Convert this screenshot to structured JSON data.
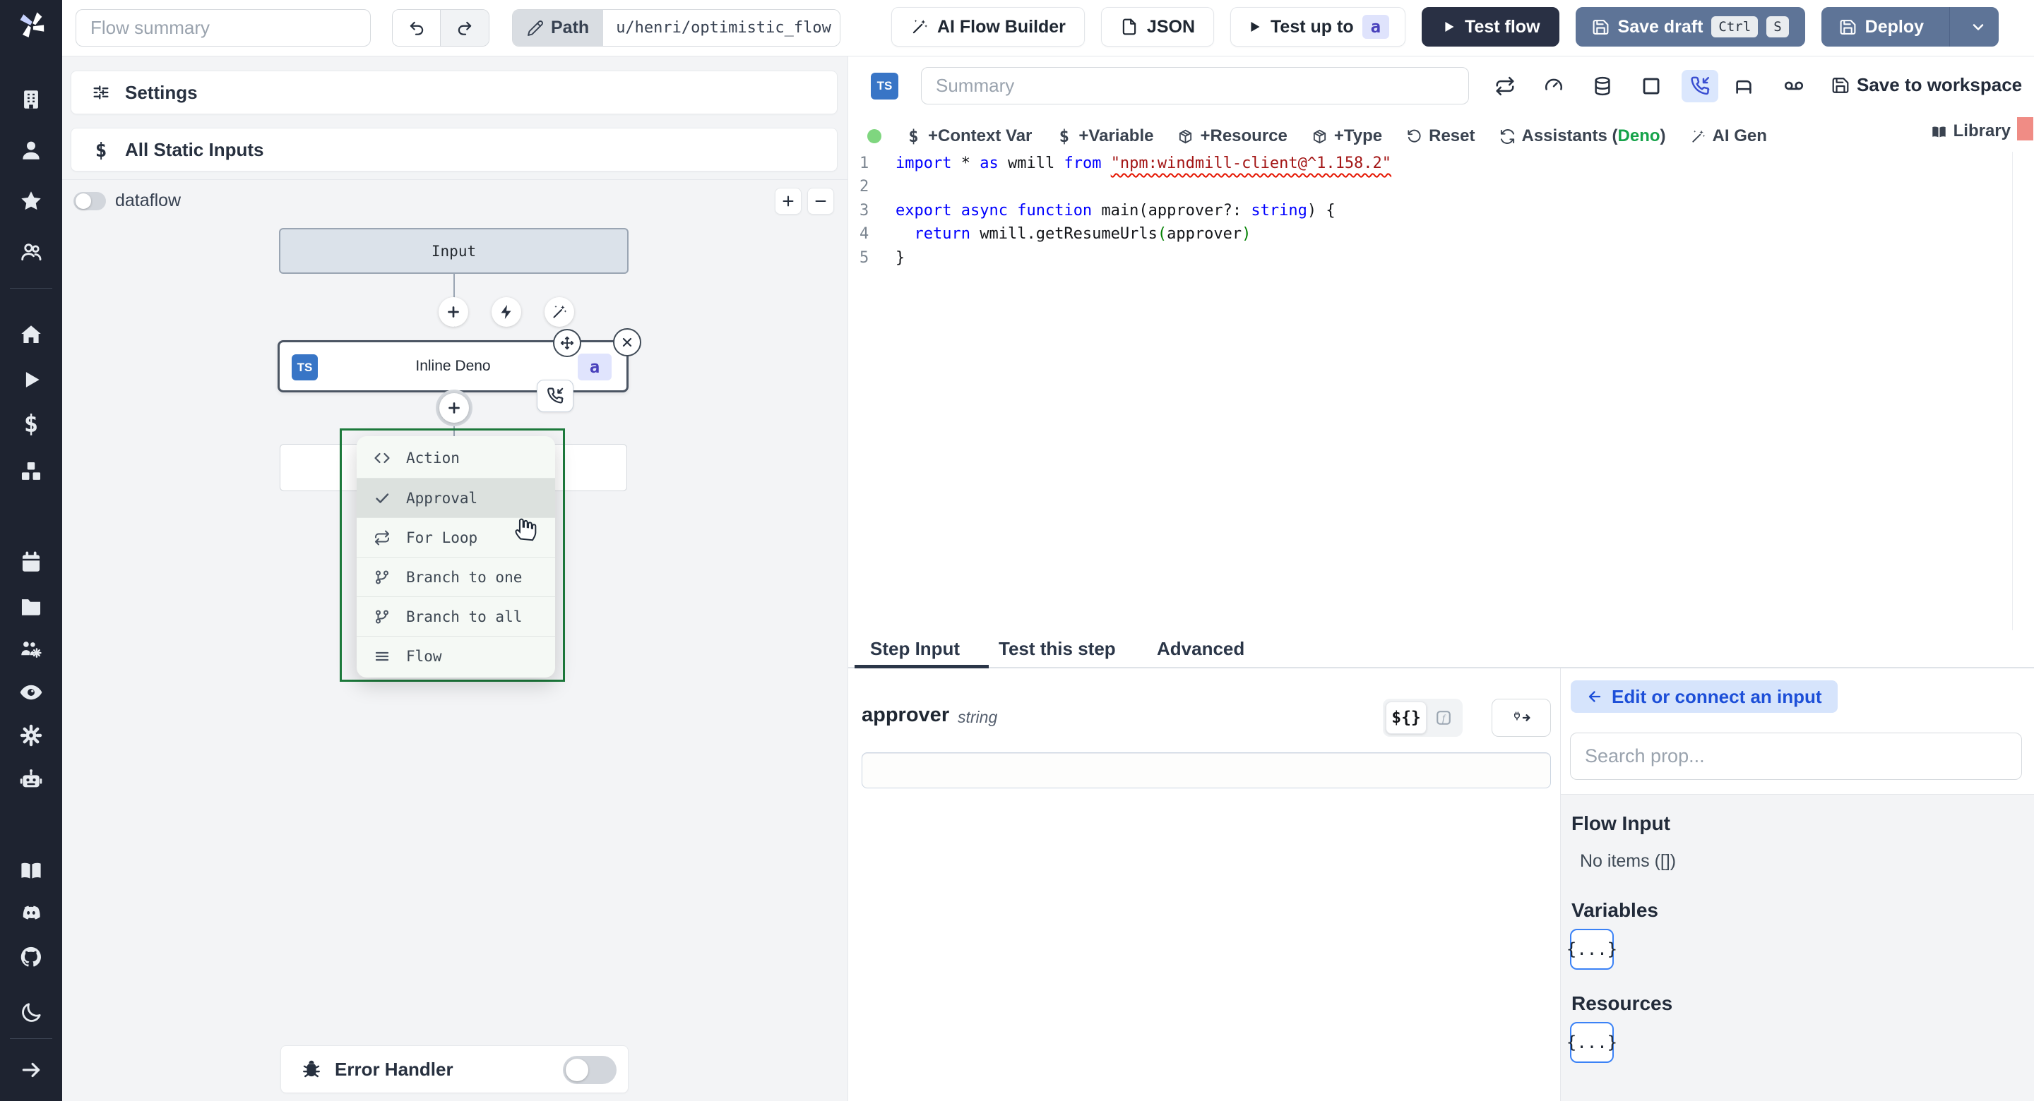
{
  "topbar": {
    "flow_summary_placeholder": "Flow summary",
    "path_label": "Path",
    "path_value": "u/henri/optimistic_flow",
    "ai_flow_builder": "AI Flow Builder",
    "json": "JSON",
    "test_up_to": "Test up to",
    "test_up_to_badge": "a",
    "test_flow": "Test flow",
    "save_draft": "Save draft",
    "kbd_ctrl": "Ctrl",
    "kbd_s": "S",
    "deploy": "Deploy"
  },
  "sidebar": {
    "items": [
      {
        "name": "workspace",
        "icon": "building"
      },
      {
        "name": "user",
        "icon": "user"
      },
      {
        "name": "favorites",
        "icon": "star"
      },
      {
        "name": "groups",
        "icon": "users"
      },
      {
        "divider": true
      },
      {
        "name": "home",
        "icon": "home"
      },
      {
        "name": "runs",
        "icon": "play"
      },
      {
        "name": "variables",
        "icon": "dollar"
      },
      {
        "name": "resources",
        "icon": "boxes"
      },
      {
        "name": "schedules",
        "icon": "calendar"
      },
      {
        "name": "folders",
        "icon": "folder"
      },
      {
        "name": "groups-admin",
        "icon": "users-cog"
      },
      {
        "name": "audit-logs",
        "icon": "eye"
      },
      {
        "name": "settings",
        "icon": "gear"
      },
      {
        "name": "workers",
        "icon": "bot"
      },
      {
        "name": "docs",
        "icon": "book"
      },
      {
        "name": "discord",
        "icon": "discord"
      },
      {
        "name": "github",
        "icon": "github"
      },
      {
        "name": "dark-mode",
        "icon": "moon"
      },
      {
        "divider": true
      },
      {
        "name": "expand-sidebar",
        "icon": "arrow-right"
      }
    ]
  },
  "flow_panel": {
    "settings": "Settings",
    "all_static_inputs": "All Static Inputs",
    "dataflow_label": "dataflow",
    "input_node": "Input",
    "step_node": "Inline Deno",
    "step_node_lang_badge": "TS",
    "step_node_id_badge": "a",
    "error_handler": "Error Handler"
  },
  "flow_menu": {
    "items": [
      {
        "label": "Action",
        "icon": "code"
      },
      {
        "label": "Approval",
        "icon": "check",
        "active": true
      },
      {
        "label": "For Loop",
        "icon": "repeat"
      },
      {
        "label": "Branch to one",
        "icon": "git-branch"
      },
      {
        "label": "Branch to all",
        "icon": "git-branch"
      },
      {
        "label": "Flow",
        "icon": "menu"
      }
    ]
  },
  "editor": {
    "lang_badge": "TS",
    "summary_placeholder": "Summary",
    "save_to_workspace": "Save to workspace",
    "toolbar": {
      "context_var": "+Context Var",
      "variable": "+Variable",
      "resource": "+Resource",
      "type": "+Type",
      "reset": "Reset",
      "assistants_prefix": "Assistants (",
      "assistants_lang": "Deno",
      "assistants_suffix": ")",
      "ai_gen": "AI Gen",
      "library": "Library"
    },
    "code": {
      "lines": [
        {
          "n": "1",
          "tokens": [
            {
              "t": "import",
              "c": "kw"
            },
            {
              "t": " * ",
              "c": "pl"
            },
            {
              "t": "as",
              "c": "kw"
            },
            {
              "t": " wmill ",
              "c": "pl"
            },
            {
              "t": "from",
              "c": "kw"
            },
            {
              "t": " ",
              "c": "pl"
            },
            {
              "t": "\"npm:windmill-client@^1.158.2\"",
              "c": "str"
            }
          ]
        },
        {
          "n": "2",
          "tokens": []
        },
        {
          "n": "3",
          "tokens": [
            {
              "t": "export",
              "c": "kw"
            },
            {
              "t": " ",
              "c": "pl"
            },
            {
              "t": "async",
              "c": "kw"
            },
            {
              "t": " ",
              "c": "pl"
            },
            {
              "t": "function",
              "c": "kw"
            },
            {
              "t": " main(approver?: ",
              "c": "pl"
            },
            {
              "t": "string",
              "c": "kw"
            },
            {
              "t": ") {",
              "c": "pl"
            }
          ]
        },
        {
          "n": "4",
          "tokens": [
            {
              "t": "  ",
              "c": "pl"
            },
            {
              "t": "return",
              "c": "kw"
            },
            {
              "t": " wmill.getResumeUrls",
              "c": "pl"
            },
            {
              "t": "(",
              "c": "grn"
            },
            {
              "t": "approver",
              "c": "pl"
            },
            {
              "t": ")",
              "c": "grn"
            }
          ]
        },
        {
          "n": "5",
          "tokens": [
            {
              "t": "}",
              "c": "pl"
            }
          ]
        }
      ]
    }
  },
  "bottom": {
    "tabs": [
      {
        "label": "Step Input",
        "active": true
      },
      {
        "label": "Test this step",
        "active": false
      },
      {
        "label": "Advanced",
        "active": false
      }
    ],
    "field_name": "approver",
    "field_type": "string",
    "expr_toggle": "${}"
  },
  "inspector": {
    "edit_connect_label": "Edit or connect an input",
    "search_placeholder": "Search prop...",
    "flow_input_title": "Flow Input",
    "flow_input_empty": "No items ([])",
    "variables_title": "Variables",
    "resources_title": "Resources",
    "object_chip": "{...}"
  },
  "colors": {
    "sidebar_bg": "#1e2330",
    "accent_blue": "#3b4fd1",
    "slate_button": "#5e7497",
    "dark_button": "#293044",
    "menu_border_green": "#1d7a3c",
    "assistants_lang_green": "#16a34a",
    "error_marker": "#f08c85",
    "ts_badge_blue": "#3875c6"
  }
}
